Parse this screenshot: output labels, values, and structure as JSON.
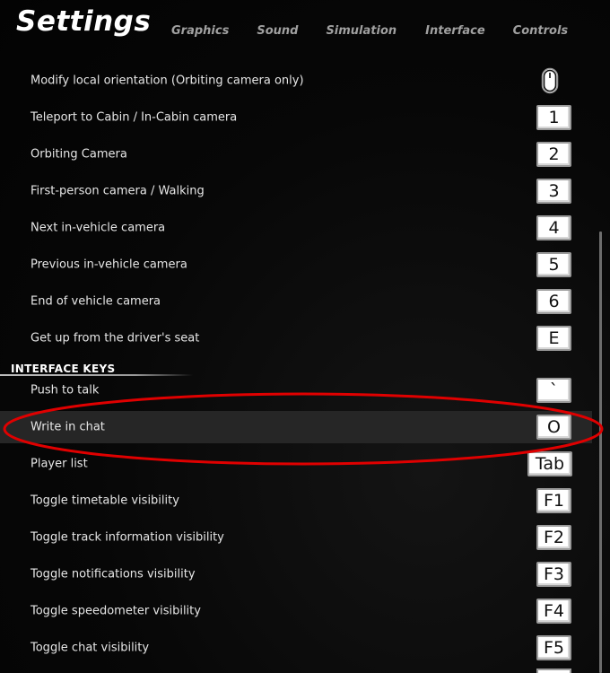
{
  "header": {
    "title": "Settings",
    "tabs": [
      "Graphics",
      "Sound",
      "Simulation",
      "Interface",
      "Controls"
    ]
  },
  "camera_bindings": [
    {
      "label": "Modify local orientation (Orbiting camera only)",
      "key": "",
      "key_icon": "mouse-icon"
    },
    {
      "label": "Teleport to Cabin / In-Cabin camera",
      "key": "1"
    },
    {
      "label": "Orbiting Camera",
      "key": "2"
    },
    {
      "label": "First-person camera / Walking",
      "key": "3"
    },
    {
      "label": "Next in-vehicle camera",
      "key": "4"
    },
    {
      "label": "Previous in-vehicle camera",
      "key": "5"
    },
    {
      "label": "End of vehicle camera",
      "key": "6"
    },
    {
      "label": "Get up from the driver's seat",
      "key": "E"
    }
  ],
  "interface_section": {
    "title": "INTERFACE KEYS",
    "bindings": [
      {
        "label": "Push to talk",
        "key": "`"
      },
      {
        "label": "Write in chat",
        "key": "O",
        "highlighted": true
      },
      {
        "label": "Player list",
        "key": "Tab"
      },
      {
        "label": "Toggle timetable visibility",
        "key": "F1"
      },
      {
        "label": "Toggle track information visibility",
        "key": "F2"
      },
      {
        "label": "Toggle notifications visibility",
        "key": "F3"
      },
      {
        "label": "Toggle speedometer visibility",
        "key": "F4"
      },
      {
        "label": "Toggle chat visibility",
        "key": "F5"
      }
    ]
  },
  "colors": {
    "background": "#060606",
    "highlight_row": "#262626",
    "annotation": "#e00000",
    "tab_text": "#a0a0a0"
  }
}
